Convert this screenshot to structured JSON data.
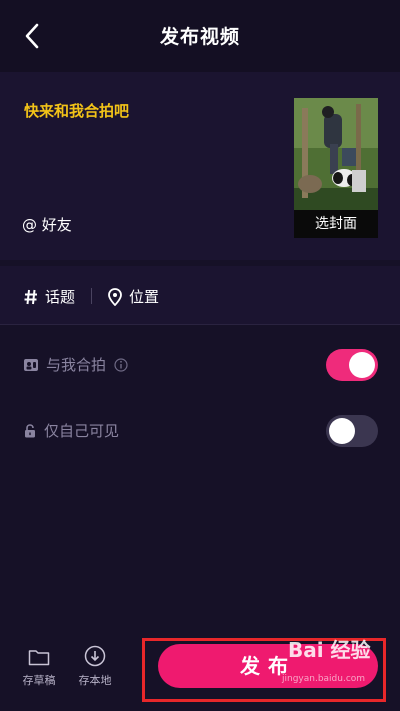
{
  "header": {
    "title": "发布视频",
    "back_icon": "chevron-left-icon"
  },
  "caption": {
    "text": "快来和我合拍吧",
    "at_friends_label": "@ 好友"
  },
  "cover": {
    "select_label": "选封面"
  },
  "tags": {
    "topic_label": "话题",
    "location_label": "位置"
  },
  "settings": {
    "duet": {
      "label": "与我合拍",
      "enabled": true,
      "icon": "duet-icon"
    },
    "private": {
      "label": "仅自己可见",
      "enabled": false,
      "icon": "lock-icon"
    }
  },
  "bottom": {
    "draft_label": "存草稿",
    "save_local_label": "存本地",
    "publish_label": "发布"
  },
  "watermark": {
    "text": "Bai 经验",
    "url": "jingyan.baidu.com"
  },
  "colors": {
    "accent": "#ef1a6f",
    "caption": "#f2c318",
    "background": "#161127",
    "highlight_frame": "#e8272a"
  }
}
